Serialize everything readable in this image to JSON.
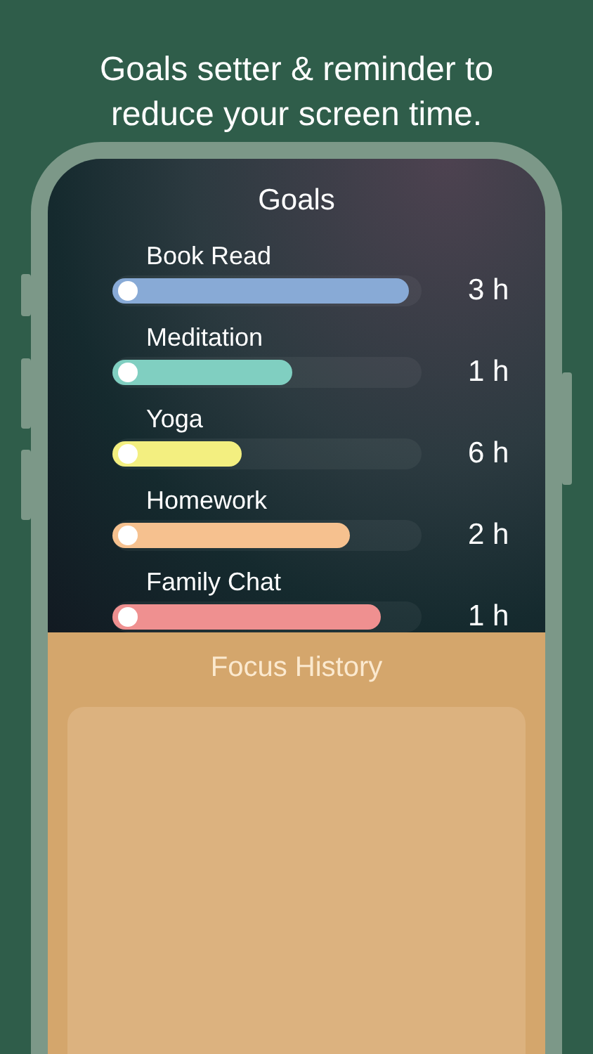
{
  "headline": "Goals setter & reminder to reduce your screen time.",
  "screen": {
    "title": "Goals",
    "goals": [
      {
        "name": "Book Read",
        "level": 0.96,
        "reading": "3 h",
        "color": "#88aad6"
      },
      {
        "name": "Meditation",
        "level": 0.58,
        "reading": "1 h",
        "color": "#80cfc1"
      },
      {
        "name": "Yoga",
        "level": 0.42,
        "reading": "6 h",
        "color": "#f3ef80"
      },
      {
        "name": "Homework",
        "level": 0.77,
        "reading": "2 h",
        "color": "#f6c18f"
      },
      {
        "name": "Family Chat",
        "level": 0.87,
        "reading": "1 h",
        "color": "#ef9090"
      }
    ],
    "history_title": "Focus History"
  }
}
